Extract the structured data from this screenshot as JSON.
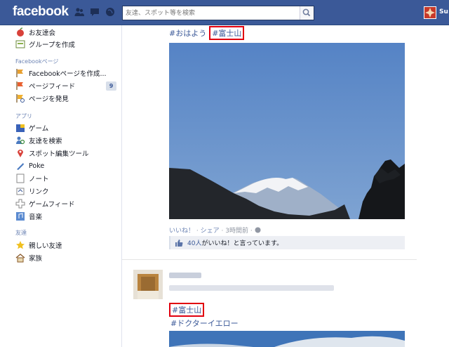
{
  "header": {
    "logo": "facebook",
    "search_placeholder": "友達、スポット等を検索",
    "user_name": "Su"
  },
  "sidebar": {
    "top_items": [
      {
        "label": "お友達会",
        "icon": "apple-icon"
      },
      {
        "label": "グループを作成",
        "icon": "group-icon"
      }
    ],
    "pages_heading": "Facebookページ",
    "pages_items": [
      {
        "label": "Facebookページを作成...",
        "icon": "page-create-icon"
      },
      {
        "label": "ページフィード",
        "icon": "page-feed-icon",
        "count": "9"
      },
      {
        "label": "ページを発見",
        "icon": "page-discover-icon"
      }
    ],
    "apps_heading": "アプリ",
    "apps_items": [
      {
        "label": "ゲーム",
        "icon": "game-icon"
      },
      {
        "label": "友達を検索",
        "icon": "find-friends-icon"
      },
      {
        "label": "スポット編集ツール",
        "icon": "place-editor-icon"
      },
      {
        "label": "Poke",
        "icon": "poke-icon"
      },
      {
        "label": "ノート",
        "icon": "note-icon"
      },
      {
        "label": "リンク",
        "icon": "link-icon"
      },
      {
        "label": "ゲームフィード",
        "icon": "game-feed-icon"
      },
      {
        "label": "音楽",
        "icon": "music-icon"
      }
    ],
    "friends_heading": "友達",
    "friends_items": [
      {
        "label": "親しい友達",
        "icon": "star-icon"
      },
      {
        "label": "家族",
        "icon": "home-icon"
      }
    ]
  },
  "post1": {
    "hashtag1": "#おはよう",
    "hashtag2": "#富士山",
    "like_link": "いいね！",
    "share_link": "シェア",
    "time": "3時間前",
    "meta_separator": " · ",
    "likes_count": "40人",
    "likes_text": "がいいね！と言っています。"
  },
  "post2": {
    "hashtag1": "#富士山",
    "hashtag2": "#ドクターイエロー"
  },
  "colors": {
    "brand": "#3b5998",
    "highlight_box": "#e1000f",
    "sky": "#4a7cc0"
  }
}
